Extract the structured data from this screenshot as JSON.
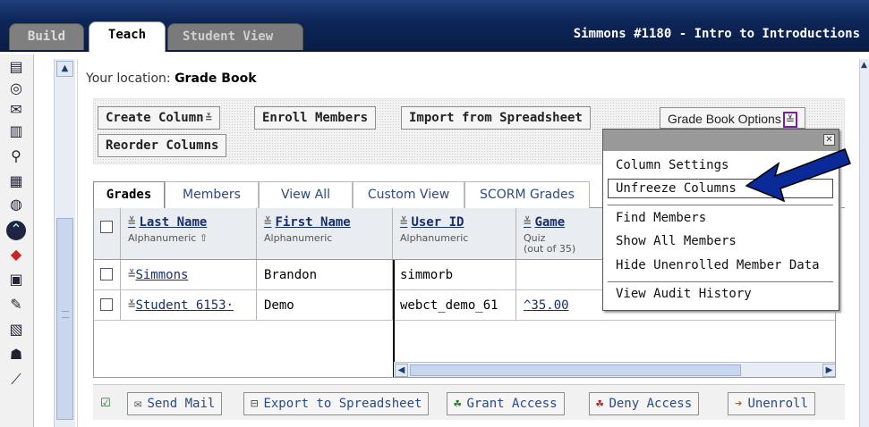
{
  "tabs": {
    "build": "Build",
    "teach": "Teach",
    "student_view": "Student View"
  },
  "course_title": "Simmons #1180 - Intro to Introductions",
  "location": {
    "prefix": "Your location:",
    "page": "Grade Book"
  },
  "toolbar": {
    "create_column": "Create Column",
    "enroll_members": "Enroll Members",
    "import_spreadsheet": "Import from Spreadsheet",
    "reorder_columns": "Reorder Columns",
    "grade_book_options": "Grade Book Options"
  },
  "subtabs": [
    "Grades",
    "Members",
    "View All",
    "Custom View",
    "SCORM Grades"
  ],
  "columns": [
    {
      "title": "Last Name",
      "sub": "Alphanumeric ⇧"
    },
    {
      "title": "First Name",
      "sub": "Alphanumeric"
    },
    {
      "title": "User ID",
      "sub": "Alphanumeric"
    },
    {
      "title": "Game",
      "sub": "Quiz",
      "sub2": "(out of 35)"
    }
  ],
  "rows": [
    {
      "last": "Simmons",
      "first": "Brandon",
      "userid": "simmorb",
      "game": ""
    },
    {
      "last": "Student 6153·",
      "first": "Demo",
      "userid": "webct_demo_61",
      "game": "^35.00"
    }
  ],
  "dropdown": {
    "items": [
      "Column Settings",
      "Unfreeze Columns",
      "Find Members",
      "Show All Members",
      "Hide Unenrolled Member Data",
      "View Audit History"
    ]
  },
  "actions": {
    "send_mail": "Send Mail",
    "export": "Export to Spreadsheet",
    "grant": "Grant Access",
    "deny": "Deny Access",
    "unenroll": "Unenroll"
  },
  "colors": {
    "topbar": "#0d2557",
    "link": "#18306a",
    "arrow": "#0a2a9a"
  }
}
